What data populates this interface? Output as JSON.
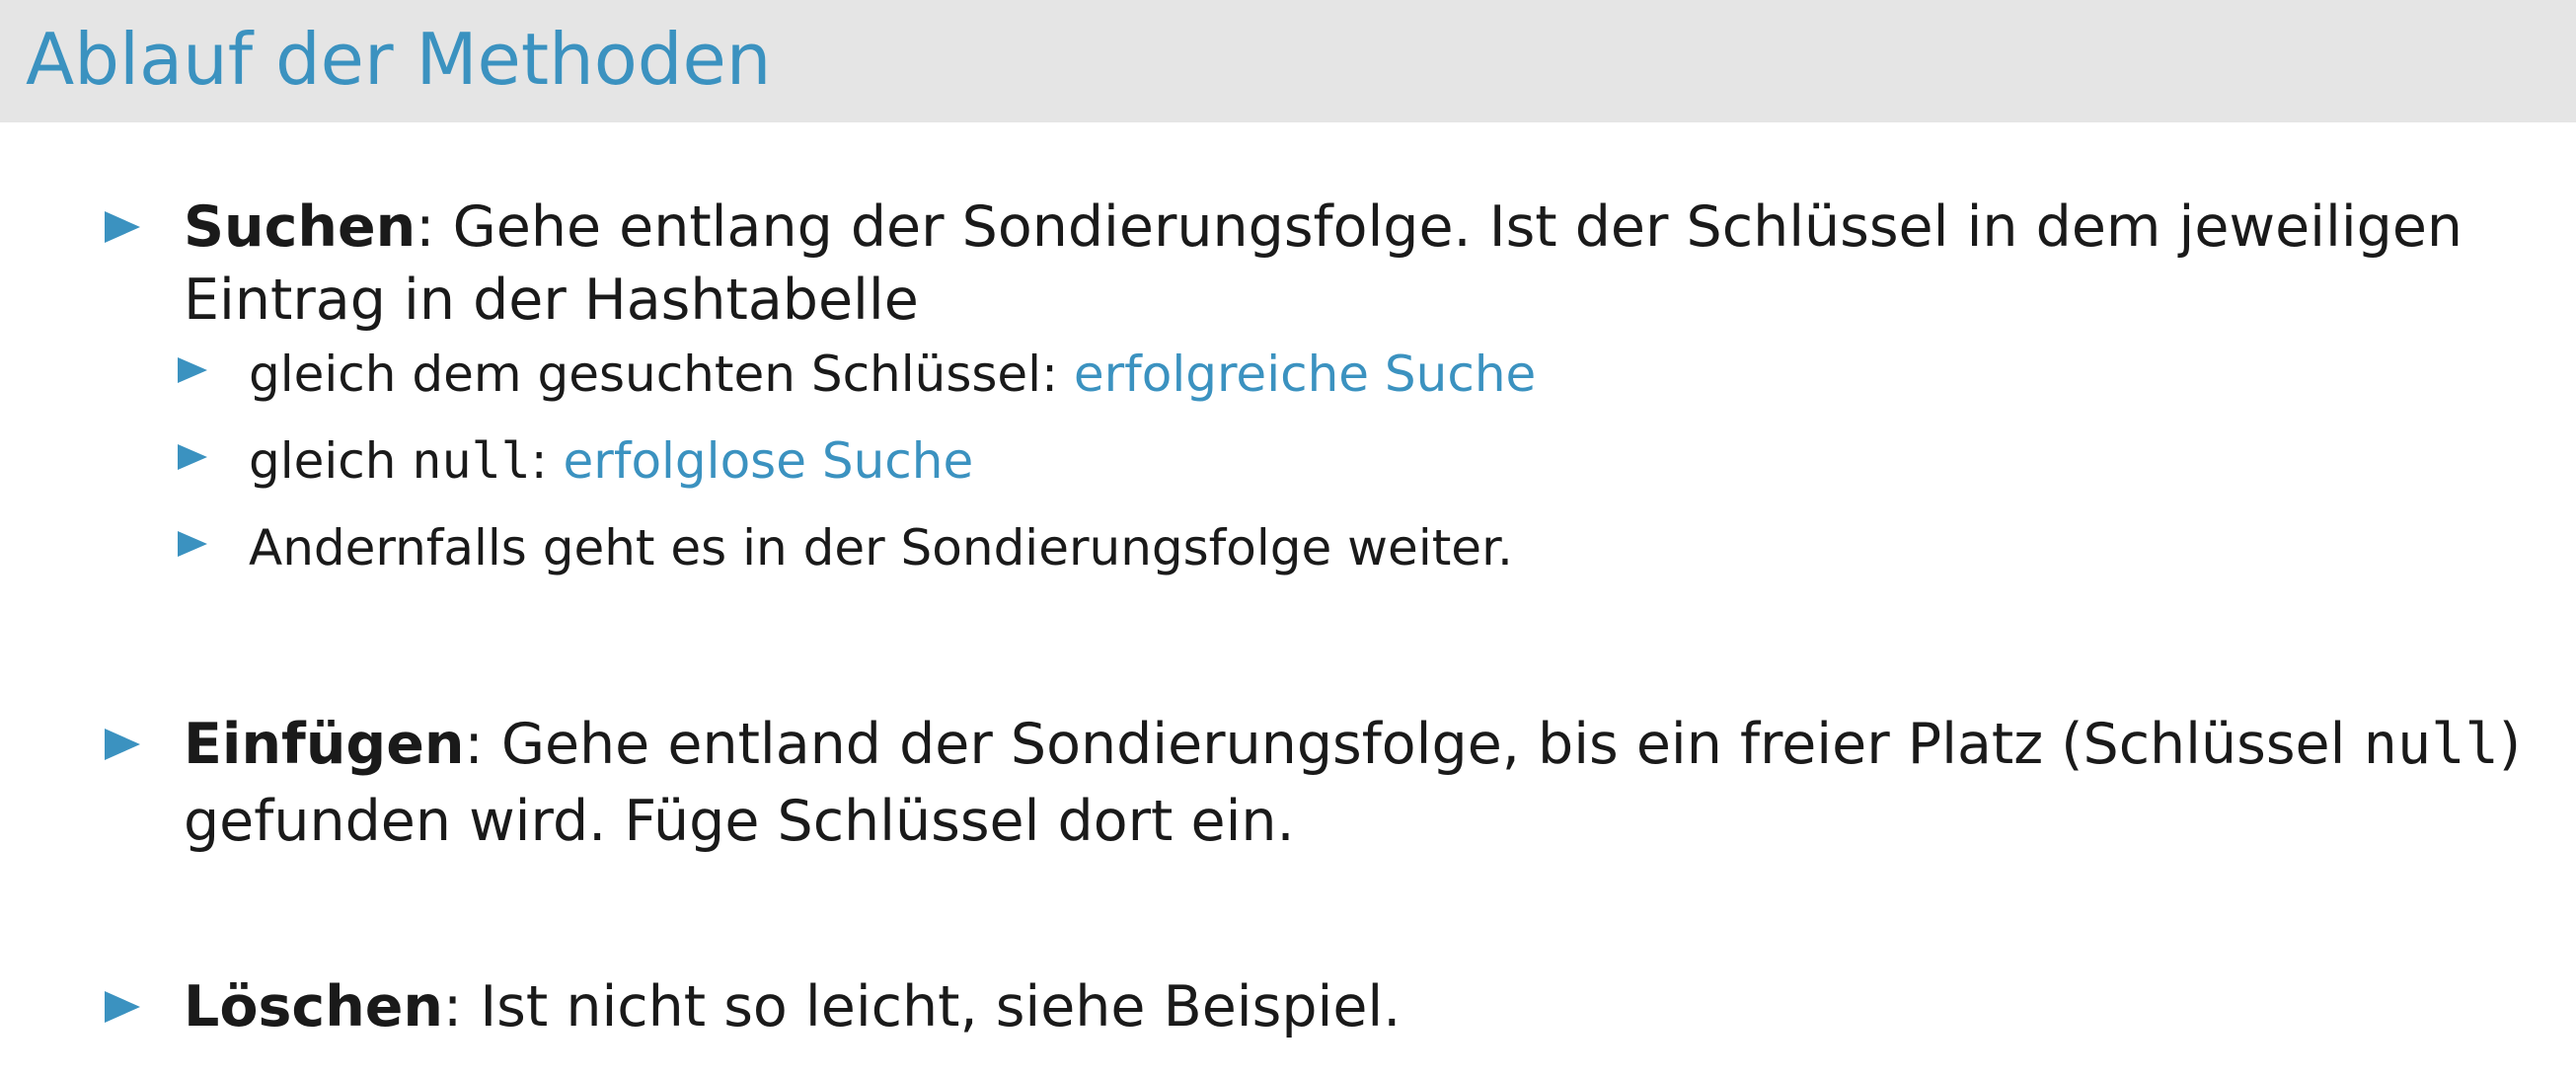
{
  "slide": {
    "title": "Ablauf der Methoden",
    "accent_color": "#3b92c0",
    "header_bg": "#e5e5e5"
  },
  "items": [
    {
      "term": "Suchen",
      "sep": ":",
      "line1": " Gehe entlang der Sondierungsfolge. Ist der Schlüssel in dem jeweiligen",
      "line2": "Eintrag in der Hashtabelle",
      "subitems": [
        {
          "text": "gleich dem gesuchten Schlüssel: ",
          "accent": "erfolgreiche Suche"
        },
        {
          "text_pre": "gleich ",
          "code": "null",
          "text_post": ": ",
          "accent": "erfolglose Suche"
        },
        {
          "text": "Andernfalls geht es in der Sondierungsfolge weiter."
        }
      ]
    },
    {
      "term": "Einfügen",
      "sep": ":",
      "line1_pre": " Gehe entland der Sondierungsfolge, bis ein freier Platz (Schlüssel ",
      "line1_code": "null",
      "line1_post": ")",
      "line2": "gefunden wird. Füge Schlüssel dort ein."
    },
    {
      "term": "Löschen",
      "sep": ":",
      "line1": " Ist nicht so leicht, siehe Beispiel."
    }
  ]
}
